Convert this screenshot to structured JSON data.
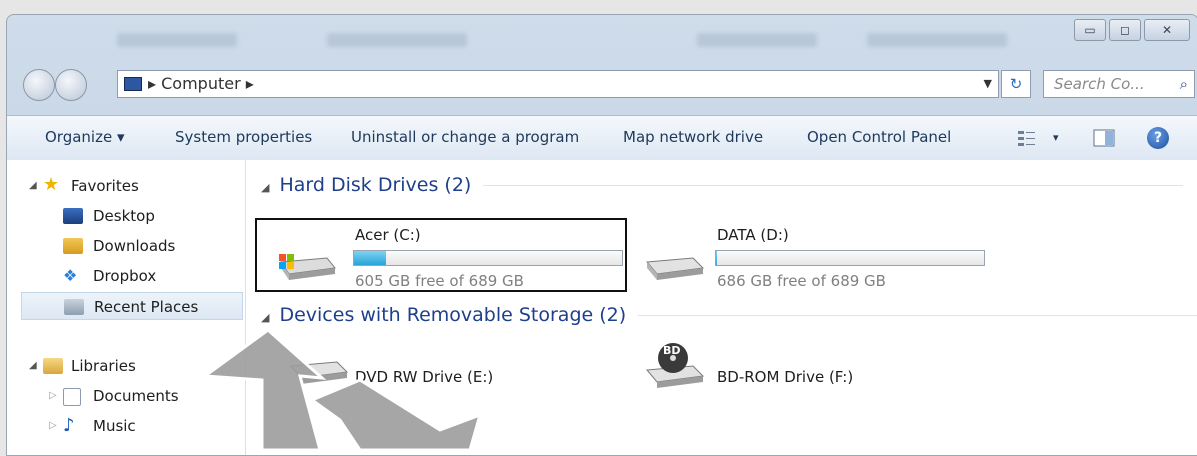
{
  "window": {
    "controls": {
      "minimize": "▭",
      "maximize": "◻",
      "close": "✕"
    }
  },
  "address_bar": {
    "crumb": "▸ Computer ▸",
    "dropdown": "▼",
    "refresh": "↻",
    "search_placeholder": "Search Co...",
    "search_icon": "magnifier-icon"
  },
  "toolbar": {
    "organize": "Organize ▾",
    "system_properties": "System properties",
    "uninstall": "Uninstall or change a program",
    "map_drive": "Map network drive",
    "control_panel": "Open Control Panel",
    "views": "▾",
    "help": "?"
  },
  "nav": {
    "favorites": "Favorites",
    "desktop": "Desktop",
    "downloads": "Downloads",
    "dropbox": "Dropbox",
    "recent": "Recent Places",
    "libraries": "Libraries",
    "documents": "Documents",
    "music": "Music"
  },
  "content": {
    "hdd_group": "Hard Disk Drives (2)",
    "removable_group": "Devices with Removable Storage (2)",
    "drives": [
      {
        "name": "Acer (C:)",
        "free": "605 GB free of 689 GB",
        "used_fraction": 0.12
      },
      {
        "name": "DATA (D:)",
        "free": "686 GB free of 689 GB",
        "used_fraction": 0.004
      }
    ],
    "removable": [
      {
        "name": "DVD RW Drive (E:)"
      },
      {
        "name": "BD-ROM Drive (F:)",
        "badge": "BD"
      }
    ]
  },
  "colors": {
    "accent": "#1e3f8c",
    "bar_fill": "#27a4d8"
  }
}
